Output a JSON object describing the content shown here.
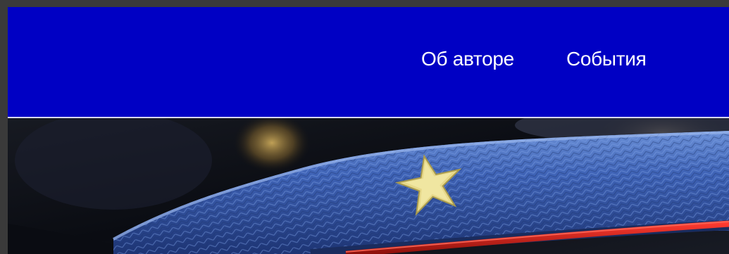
{
  "nav": {
    "items": [
      {
        "label": "Об авторе"
      },
      {
        "label": "События"
      }
    ]
  },
  "colors": {
    "header_background": "#0000c4",
    "nav_text": "#ffffff",
    "divider": "#d7d7ef",
    "frame": "#3a3a3a"
  },
  "hero": {
    "image": "epaulette-with-gold-star-photo"
  }
}
